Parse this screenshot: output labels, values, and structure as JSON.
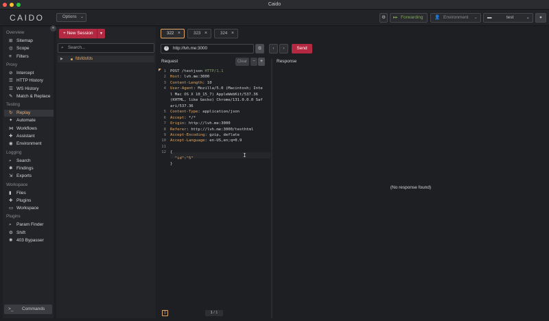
{
  "window": {
    "title": "Caido"
  },
  "app": {
    "logo_text": "CAIDO",
    "options_label": "Options",
    "forwarding_label": "Forwarding",
    "environment_label": "Environment",
    "project_label": "test"
  },
  "sidebar": {
    "sections": [
      {
        "title": "Overview",
        "items": [
          {
            "label": "Sitemap",
            "icon": "sitemap-icon"
          },
          {
            "label": "Scope",
            "icon": "scope-icon"
          },
          {
            "label": "Filters",
            "icon": "filter-icon"
          }
        ]
      },
      {
        "title": "Proxy",
        "items": [
          {
            "label": "Intercept",
            "icon": "intercept-icon"
          },
          {
            "label": "HTTP History",
            "icon": "list-icon"
          },
          {
            "label": "WS History",
            "icon": "list-icon"
          },
          {
            "label": "Match & Replace",
            "icon": "wrench-icon"
          }
        ]
      },
      {
        "title": "Testing",
        "items": [
          {
            "label": "Replay",
            "icon": "replay-icon",
            "active": true
          },
          {
            "label": "Automate",
            "icon": "automate-icon"
          },
          {
            "label": "Workflows",
            "icon": "workflow-icon"
          },
          {
            "label": "Assistant",
            "icon": "assistant-icon"
          },
          {
            "label": "Environment",
            "icon": "globe-icon"
          }
        ]
      },
      {
        "title": "Logging",
        "items": [
          {
            "label": "Search",
            "icon": "search-icon"
          },
          {
            "label": "Findings",
            "icon": "findings-icon"
          },
          {
            "label": "Exports",
            "icon": "exports-icon"
          }
        ]
      },
      {
        "title": "Workspace",
        "items": [
          {
            "label": "Files",
            "icon": "file-icon"
          },
          {
            "label": "Plugins",
            "icon": "plugin-icon"
          },
          {
            "label": "Workspace",
            "icon": "monitor-icon"
          }
        ]
      },
      {
        "title": "Plugins",
        "items": [
          {
            "label": "Param Finder",
            "icon": "search-icon"
          },
          {
            "label": "Shift",
            "icon": "shift-icon"
          },
          {
            "label": "403 Bypasser",
            "icon": "gear-icon"
          }
        ]
      }
    ],
    "commands_label": "Commands"
  },
  "sessions": {
    "new_session_label": "New Session",
    "search_placeholder": "Search...",
    "items": [
      {
        "label": "fdsfdsfds"
      }
    ]
  },
  "tabs": [
    {
      "label": "322",
      "active": true
    },
    {
      "label": "323",
      "active": false
    },
    {
      "label": "324",
      "active": false
    }
  ],
  "request": {
    "url": "http://lvh.me:3000",
    "send_label": "Send",
    "pane_title": "Request",
    "clear_label": "Clear",
    "lines": [
      {
        "n": "1",
        "parts": [
          {
            "t": "POST /testjson ",
            "c": ""
          },
          {
            "t": "HTTP/1.1",
            "c": "g"
          }
        ]
      },
      {
        "n": "2",
        "parts": [
          {
            "t": "Host",
            "c": "k"
          },
          {
            "t": ": lvh.me:3000",
            "c": ""
          }
        ]
      },
      {
        "n": "3",
        "parts": [
          {
            "t": "Content-Length",
            "c": "k"
          },
          {
            "t": ": 10",
            "c": ""
          }
        ]
      },
      {
        "n": "4",
        "parts": [
          {
            "t": "User-Agent",
            "c": "k"
          },
          {
            "t": ": Mozilla/5.0 (Macintosh; Inte",
            "c": ""
          }
        ]
      },
      {
        "n": "",
        "parts": [
          {
            "t": "l Mac OS X 10_15_7) AppleWebKit/537.36",
            "c": ""
          }
        ]
      },
      {
        "n": "",
        "parts": [
          {
            "t": "(KHTML, like Gecko) Chrome/131.0.0.0 Saf",
            "c": ""
          }
        ]
      },
      {
        "n": "",
        "parts": [
          {
            "t": "ari/537.36",
            "c": ""
          }
        ]
      },
      {
        "n": "5",
        "parts": [
          {
            "t": "Content-Type",
            "c": "k"
          },
          {
            "t": ": application/json",
            "c": ""
          }
        ]
      },
      {
        "n": "6",
        "parts": [
          {
            "t": "Accept",
            "c": "k"
          },
          {
            "t": ": */*",
            "c": ""
          }
        ]
      },
      {
        "n": "7",
        "parts": [
          {
            "t": "Origin",
            "c": "k"
          },
          {
            "t": ": http://lvh.me:3000",
            "c": ""
          }
        ]
      },
      {
        "n": "8",
        "parts": [
          {
            "t": "Referer",
            "c": "k"
          },
          {
            "t": ": http://lvh.me:3000/testhtml",
            "c": ""
          }
        ]
      },
      {
        "n": "9",
        "parts": [
          {
            "t": "Accept-Encoding",
            "c": "k"
          },
          {
            "t": ": gzip, deflate",
            "c": ""
          }
        ]
      },
      {
        "n": "10",
        "parts": [
          {
            "t": "Accept-Language",
            "c": "k"
          },
          {
            "t": ": en-US,en;q=0.9",
            "c": ""
          }
        ]
      },
      {
        "n": "11",
        "parts": [
          {
            "t": "",
            "c": ""
          }
        ]
      },
      {
        "n": "12",
        "parts": [
          {
            "t": "{",
            "c": ""
          }
        ]
      },
      {
        "n": "",
        "parts": [
          {
            "t": "  ",
            "c": ""
          },
          {
            "t": "\"id\"",
            "c": "k"
          },
          {
            "t": ":",
            "c": ""
          },
          {
            "t": "\"5\"",
            "c": "k"
          }
        ]
      },
      {
        "n": "",
        "parts": [
          {
            "t": "}",
            "c": ""
          }
        ]
      }
    ],
    "page_current": "1",
    "page_total": "1"
  },
  "response": {
    "pane_title": "Response",
    "empty_text": "(No response found)"
  },
  "colors": {
    "accent": "#e2aa6b",
    "send": "#b42942",
    "forwarding": "#7fa65a"
  }
}
